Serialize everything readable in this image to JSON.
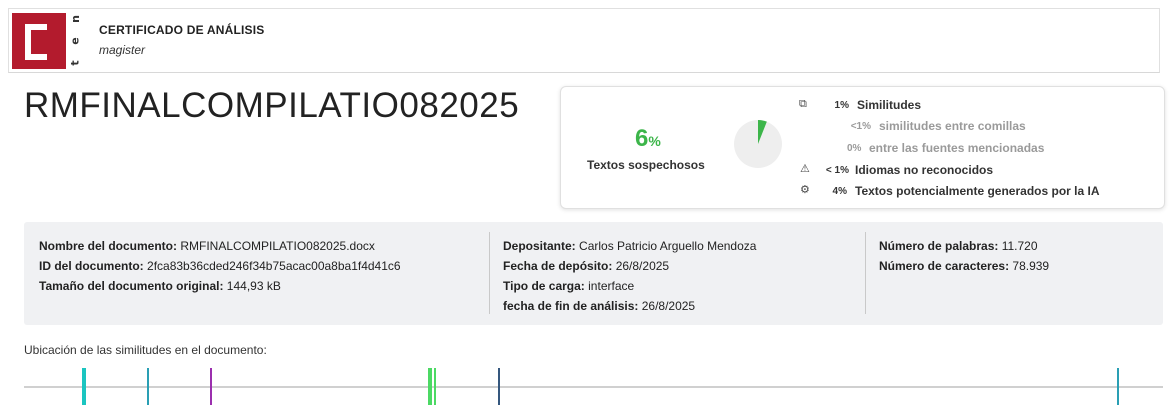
{
  "header": {
    "logo_text": "C net",
    "title": "CERTIFICADO DE ANÁLISIS",
    "subtitle": "magister"
  },
  "document_title": "RMFINALCOMPILATIO082025",
  "summary": {
    "percent": "6",
    "percent_sign": "%",
    "label": "Textos sospechosos",
    "accent_color": "#3cb54a",
    "donut_fraction": 0.06,
    "stats": [
      {
        "icon": "similarity-icon",
        "value": "1%",
        "label": "Similitudes"
      },
      {
        "icon": "",
        "value": "<1%",
        "label": "similitudes entre comillas"
      },
      {
        "icon": "",
        "value": "0%",
        "label": "entre las fuentes mencionadas"
      },
      {
        "icon": "warning-icon",
        "value": "< 1%",
        "label": "Idiomas no reconocidos"
      },
      {
        "icon": "ai-icon",
        "value": "4%",
        "label": "Textos potencialmente generados por la IA"
      }
    ]
  },
  "info": {
    "col1": [
      {
        "key": "Nombre del documento:",
        "value": "RMFINALCOMPILATIO082025.docx"
      },
      {
        "key": "ID del documento:",
        "value": "2fca83b36cded246f34b75acac00a8ba1f4d41c6"
      },
      {
        "key": "Tamaño del documento original:",
        "value": "144,93 kB"
      }
    ],
    "col2": [
      {
        "key": "Depositante:",
        "value": "Carlos Patricio Arguello Mendoza"
      },
      {
        "key": "Fecha de depósito:",
        "value": "26/8/2025"
      },
      {
        "key": "Tipo de carga:",
        "value": "interface"
      },
      {
        "key": "fecha de fin de análisis:",
        "value": "26/8/2025"
      }
    ],
    "col3": [
      {
        "key": "Número de palabras:",
        "value": "11.720"
      },
      {
        "key": "Número de caracteres:",
        "value": "78.939"
      }
    ]
  },
  "location": {
    "label": "Ubicación de las similitudes en el documento:",
    "marks": [
      {
        "pos": 0.051,
        "color": "#1bc5c0",
        "thick": true
      },
      {
        "pos": 0.108,
        "color": "#2a9fb4",
        "thick": false
      },
      {
        "pos": 0.163,
        "color": "#9b2fae",
        "thick": false
      },
      {
        "pos": 0.355,
        "color": "#4cd964",
        "thick": true
      },
      {
        "pos": 0.36,
        "color": "#4cd964",
        "thick": false
      },
      {
        "pos": 0.416,
        "color": "#35577e",
        "thick": false
      },
      {
        "pos": 0.96,
        "color": "#2a9fb4",
        "thick": false
      }
    ]
  }
}
